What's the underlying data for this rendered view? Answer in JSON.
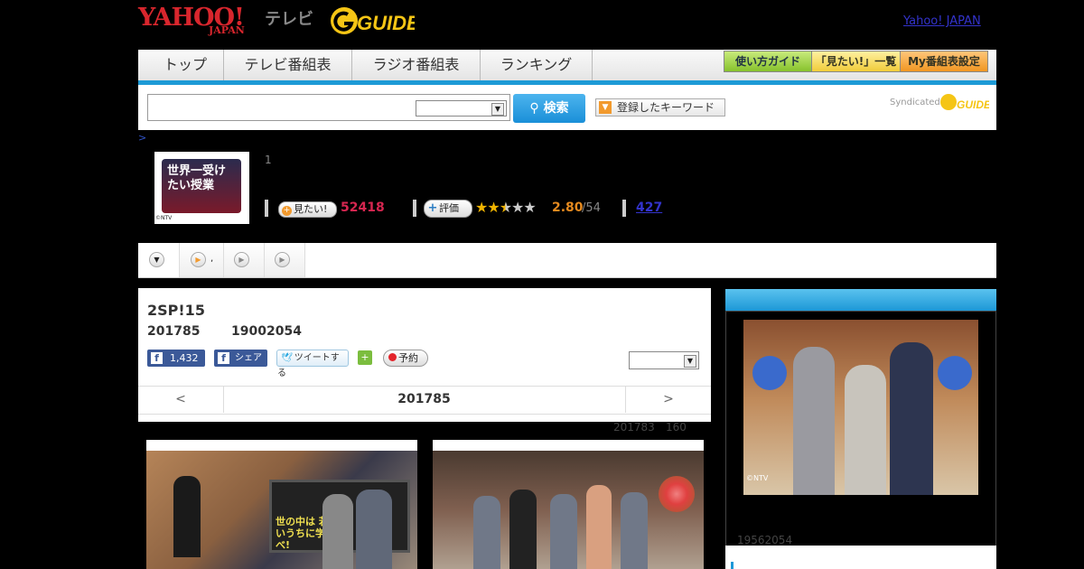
{
  "header": {
    "yahoo_logo": "YAHOO!",
    "japan_logo": "JAPAN",
    "tv_logo": "テレビ",
    "gguide_logo": "G-GUIDE",
    "yahoo_japan_link": "Yahoo! JAPAN"
  },
  "nav": {
    "tabs": [
      "トップ",
      "テレビ番組表",
      "ラジオ番組表",
      "ランキング"
    ],
    "buttons": [
      "使い方ガイド",
      "「見たい!」一覧",
      "My番組表設定"
    ]
  },
  "search": {
    "button_label": "検索",
    "keyword_button": "登録したキーワード",
    "syndicated": "Syndicated"
  },
  "program": {
    "breadcrumb": ">",
    "episode_no": "1",
    "mitai_label": "見たい!",
    "mitai_count": "52418",
    "hyouka_label": "評価",
    "stars": 2.5,
    "score": "2.80",
    "score_denominator": "/54",
    "comments": "427",
    "thumb_copyright": "©NTV",
    "thumb_title": "世界一受けたい授業"
  },
  "main": {
    "title": "2SP!15",
    "date": "201785",
    "id": "19002054",
    "fb_count": "1,432",
    "share_label": "シェア",
    "tweet_label": "ツイートする",
    "yoyaku_label": "予約",
    "prev_label": "<",
    "next_label": ">",
    "nav_date": "201785",
    "prev_broadcast": "201783",
    "prev_count": "160"
  },
  "photos": {
    "photo2_caption": "世の中は 若いうちに学べ!"
  },
  "right": {
    "copyright": "©NTV",
    "bottom_id": "19562054"
  }
}
